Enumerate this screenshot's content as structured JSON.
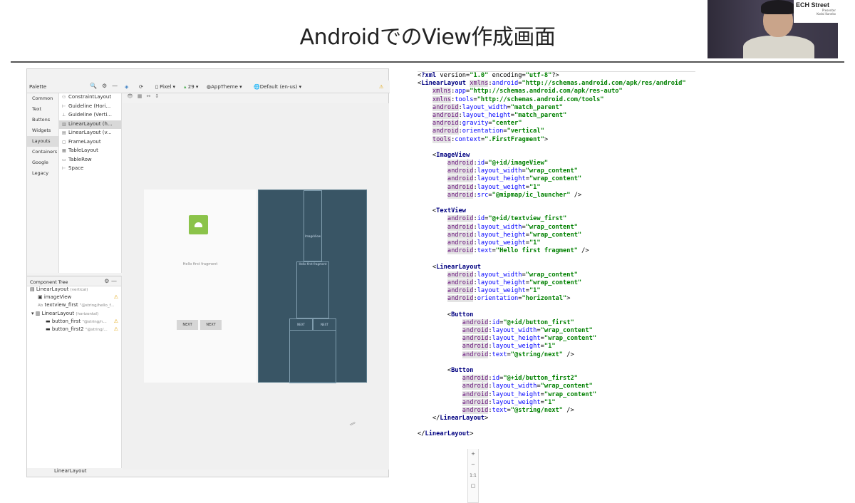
{
  "slide": {
    "title": "AndroidでのView作成画面"
  },
  "webcam": {
    "logo_text": "ECH Street",
    "presenter_label": "Presenter",
    "presenter_name": "Kodai Kaneko"
  },
  "ide": {
    "palette_label": "Palette",
    "toolbar": {
      "device": "Pixel",
      "api": "29",
      "theme": "AppTheme",
      "locale": "Default (en-us)"
    },
    "categories": [
      "Common",
      "Text",
      "Buttons",
      "Widgets",
      "Layouts",
      "Containers",
      "Google",
      "Legacy"
    ],
    "selected_category": "Layouts",
    "palette_items": [
      {
        "icon": "constraint-layout-icon",
        "label": "ConstraintLayout"
      },
      {
        "icon": "guideline-horizontal-icon",
        "label": "Guideline (Hori..."
      },
      {
        "icon": "guideline-vertical-icon",
        "label": "Guideline (Verti..."
      },
      {
        "icon": "linear-layout-horizontal-icon",
        "label": "LinearLayout (h..."
      },
      {
        "icon": "linear-layout-vertical-icon",
        "label": "LinearLayout (v..."
      },
      {
        "icon": "frame-layout-icon",
        "label": "FrameLayout"
      },
      {
        "icon": "table-layout-icon",
        "label": "TableLayout"
      },
      {
        "icon": "table-row-icon",
        "label": "TableRow"
      },
      {
        "icon": "space-icon",
        "label": "Space"
      }
    ],
    "component_tree": {
      "label": "Component Tree",
      "rows": [
        {
          "label": "LinearLayout",
          "sub": "(vertical)",
          "warn": false
        },
        {
          "label": "imageView",
          "sub": "",
          "warn": true
        },
        {
          "label": "textview_first",
          "sub": "\"@string/hello_f...",
          "warn": true
        },
        {
          "label": "LinearLayout",
          "sub": "(horizontal)",
          "warn": false
        },
        {
          "label": "button_first",
          "sub": "\"@string/n...",
          "warn": true
        },
        {
          "label": "button_first2",
          "sub": "\"@string/...",
          "warn": true
        }
      ]
    },
    "design": {
      "hello_text": "Hello first fragment",
      "btn1": "NEXT",
      "btn2": "NEXT",
      "bp_image": "ImageView",
      "bp_text": "Hello first fragment",
      "bp_btn1": "NEXT",
      "bp_btn2": "NEXT"
    },
    "zoom_controls": {
      "plus": "+",
      "minus": "−",
      "ratio": "1:1"
    },
    "status_bar": "LinearLayout"
  },
  "xml_lines": [
    "<?xml version=\"1.0\" encoding=\"utf-8\"?>",
    "<LinearLayout xmlns:android=\"http://schemas.android.com/apk/res/android\"",
    "    xmlns:app=\"http://schemas.android.com/apk/res-auto\"",
    "    xmlns:tools=\"http://schemas.android.com/tools\"",
    "    android:layout_width=\"match_parent\"",
    "    android:layout_height=\"match_parent\"",
    "    android:gravity=\"center\"",
    "    android:orientation=\"vertical\"",
    "    tools:context=\".FirstFragment\">",
    "",
    "    <ImageView",
    "        android:id=\"@+id/imageView\"",
    "        android:layout_width=\"wrap_content\"",
    "        android:layout_height=\"wrap_content\"",
    "        android:layout_weight=\"1\"",
    "        android:src=\"@mipmap/ic_launcher\" />",
    "",
    "    <TextView",
    "        android:id=\"@+id/textview_first\"",
    "        android:layout_width=\"wrap_content\"",
    "        android:layout_height=\"wrap_content\"",
    "        android:layout_weight=\"1\"",
    "        android:text=\"Hello first fragment\" />",
    "",
    "    <LinearLayout",
    "        android:layout_width=\"wrap_content\"",
    "        android:layout_height=\"wrap_content\"",
    "        android:layout_weight=\"1\"",
    "        android:orientation=\"horizontal\">",
    "",
    "        <Button",
    "            android:id=\"@+id/button_first\"",
    "            android:layout_width=\"wrap_content\"",
    "            android:layout_height=\"wrap_content\"",
    "            android:layout_weight=\"1\"",
    "            android:text=\"@string/next\" />",
    "",
    "        <Button",
    "            android:id=\"@+id/button_first2\"",
    "            android:layout_width=\"wrap_content\"",
    "            android:layout_height=\"wrap_content\"",
    "            android:layout_weight=\"1\"",
    "            android:text=\"@string/next\" />",
    "    </LinearLayout>",
    "",
    "</LinearLayout>"
  ]
}
